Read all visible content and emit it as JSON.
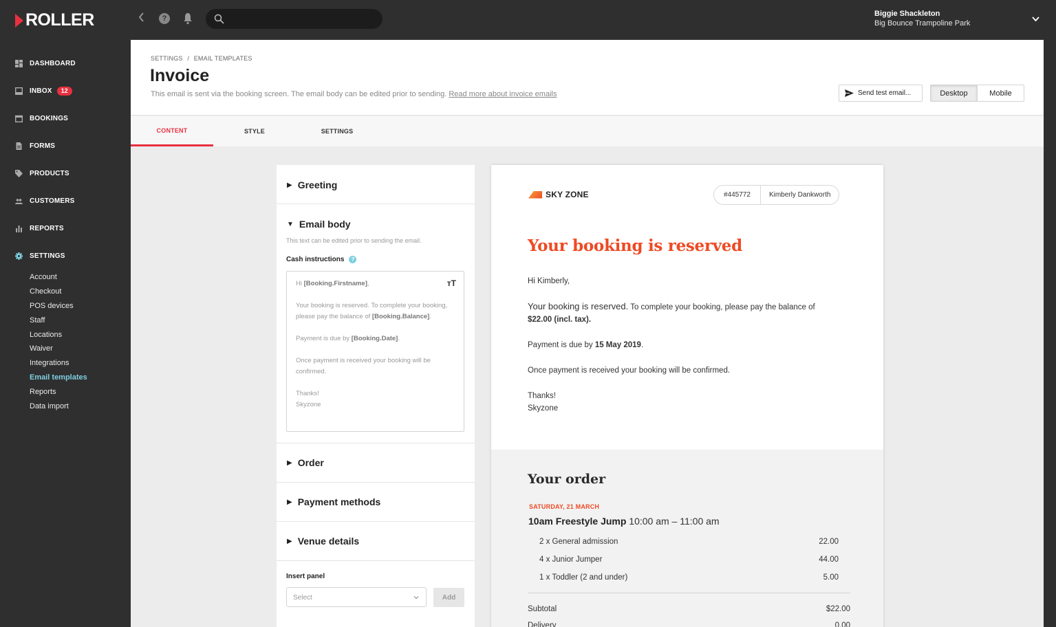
{
  "app": {
    "logo": "ROLLER",
    "search_placeholder": "",
    "user": {
      "name": "Biggie Shackleton",
      "venue": "Big Bounce Trampoline Park"
    }
  },
  "sidebar": {
    "items": [
      {
        "label": "DASHBOARD",
        "icon": "dashboard-icon"
      },
      {
        "label": "INBOX",
        "icon": "inbox-icon",
        "badge": "12"
      },
      {
        "label": "BOOKINGS",
        "icon": "calendar-icon"
      },
      {
        "label": "FORMS",
        "icon": "document-icon"
      },
      {
        "label": "PRODUCTS",
        "icon": "tag-icon"
      },
      {
        "label": "CUSTOMERS",
        "icon": "people-icon"
      },
      {
        "label": "REPORTS",
        "icon": "bar-chart-icon"
      },
      {
        "label": "SETTINGS",
        "icon": "gear-icon",
        "active": true
      }
    ],
    "settings_sub": [
      "Account",
      "Checkout",
      "POS devices",
      "Staff",
      "Locations",
      "Waiver",
      "Integrations",
      "Email templates",
      "Reports",
      "Data import"
    ],
    "active_sub": "Email templates",
    "accent": "#7dcfe0"
  },
  "header": {
    "breadcrumb": [
      "SETTINGS",
      "EMAIL TEMPLATES"
    ],
    "breadcrumb_sep": "/",
    "title": "Invoice",
    "description": "This email is sent via the booking screen. The email body can be edited prior to sending.",
    "link": "Read more about invoice emails",
    "send_test": "Send test email...",
    "view_toggle": {
      "options": [
        "Desktop",
        "Mobile"
      ],
      "selected": "Desktop"
    }
  },
  "tabs": {
    "items": [
      "CONTENT",
      "STYLE",
      "SETTINGS"
    ],
    "active": "CONTENT",
    "accent": "#e8303f"
  },
  "editor": {
    "sections": [
      {
        "title": "Greeting",
        "expanded": false
      },
      {
        "title": "Email body",
        "expanded": true
      },
      {
        "title": "Order",
        "expanded": false
      },
      {
        "title": "Payment methods",
        "expanded": false
      },
      {
        "title": "Venue details",
        "expanded": false
      }
    ],
    "email_body": {
      "helper": "This text can be edited prior to sending the email.",
      "field_label": "Cash instructions",
      "text": {
        "greeting_prefix": "Hi ",
        "firstname_token": "[Booking.Firstname]",
        "greeting_suffix": ",",
        "p1": "Your booking is reserved. To complete your booking, please pay the balance of ",
        "balance_token": "[Booking.Balance]",
        "p1_end": ".",
        "p2": "Payment is due by ",
        "date_token": "[Booking.Date]",
        "p2_end": ".",
        "p3": "Once payment is received your booking will be confirmed.",
        "thanks": "Thanks!",
        "signoff": "Skyzone"
      }
    },
    "insert_panel": {
      "label": "Insert panel",
      "placeholder": "Select",
      "add": "Add"
    }
  },
  "preview": {
    "brand": "SKY ZONE",
    "booking_ref": "#445772",
    "customer": "Kimberly Dankworth",
    "headline": "Your booking is reserved",
    "headline_color": "#ee4a24",
    "greeting": "Hi Kimberly,",
    "lead": "Your booking is reserved.",
    "lead_rest": " To complete your booking, please pay the balance of",
    "balance": "$22.00 (incl. tax).",
    "due_prefix": "Payment is due by ",
    "due_date": "15 May 2019",
    "due_suffix": ".",
    "confirm": "Once payment is received your booking will be confirmed.",
    "thanks": "Thanks!",
    "signoff": "Skyzone",
    "order": {
      "title": "Your order",
      "date": "SATURDAY, 21 MARCH",
      "session_name": "10am Freestyle Jump",
      "session_time": " 10:00 am – 11:00 am",
      "items": [
        {
          "label": "2 x General admission",
          "amount": "22.00"
        },
        {
          "label": "4 x Junior Jumper",
          "amount": "44.00"
        },
        {
          "label": "1 x Toddler (2 and under)",
          "amount": "5.00"
        }
      ],
      "totals": [
        {
          "label": "Subtotal",
          "amount": "$22.00"
        },
        {
          "label": "Delivery",
          "amount": "0.00"
        }
      ]
    }
  }
}
